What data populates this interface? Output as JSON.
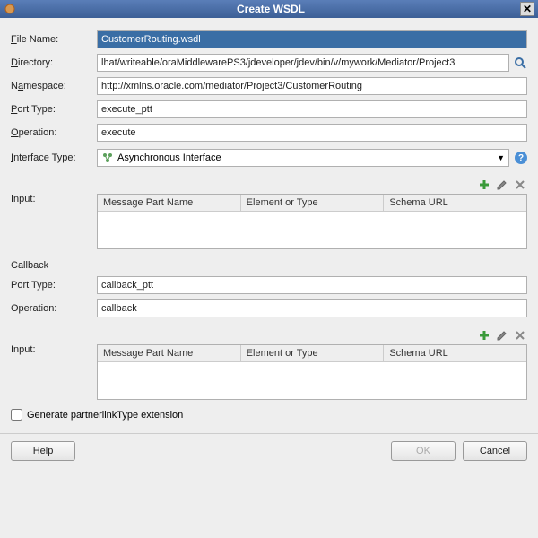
{
  "title": "Create WSDL",
  "labels": {
    "fileName": "File Name:",
    "directory": "Directory:",
    "namespace": "Namespace:",
    "portType": "Port Type:",
    "operation": "Operation:",
    "interfaceType": "Interface Type:",
    "input": "Input:",
    "callback": "Callback",
    "callbackPortType": "Port Type:",
    "callbackOperation": "Operation:",
    "callbackInput": "Input:",
    "checkbox": "Generate partnerlinkType extension"
  },
  "values": {
    "fileName": "CustomerRouting.wsdl",
    "directory": "lhat/writeable/oraMiddlewarePS3/jdeveloper/jdev/bin/v/mywork/Mediator/Project3",
    "namespace": "http://xmlns.oracle.com/mediator/Project3/CustomerRouting",
    "portType": "execute_ptt",
    "operation": "execute",
    "interfaceType": "Asynchronous Interface",
    "callbackPortType": "callback_ptt",
    "callbackOperation": "callback",
    "generatePartnerlink": false
  },
  "table": {
    "cols": [
      "Message Part Name",
      "Element or Type",
      "Schema URL"
    ]
  },
  "buttons": {
    "help": "Help",
    "ok": "OK",
    "cancel": "Cancel"
  }
}
